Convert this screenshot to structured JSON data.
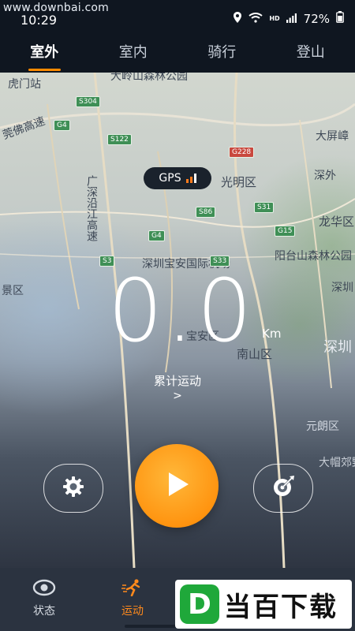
{
  "watermark_top": "www.downbai.com",
  "status": {
    "time": "10:29",
    "hd": "HD",
    "battery": "72%"
  },
  "tabs": [
    {
      "label": "室外",
      "active": true
    },
    {
      "label": "室内"
    },
    {
      "label": "骑行"
    },
    {
      "label": "登山"
    }
  ],
  "map": {
    "labels": {
      "humen": "虎门站",
      "dalingshan": "大岭山森林公园",
      "wanguo": "莞佛高速",
      "daping": "大屏嶂",
      "guangming": "光明区",
      "shenzhen_w": "深外",
      "guangshen": "广深沿江高速",
      "longhua": "龙华区",
      "yangtai": "阳台山森林公园",
      "shenzhen2": "深圳",
      "airport": "深圳宝安国际机场",
      "jingqu": "景区",
      "baoan": "宝安区",
      "nanshan": "南山区",
      "futian": "深圳",
      "yuanlang": "元朗区",
      "damao": "大帽郊野公园"
    },
    "roads": {
      "s304": "S304",
      "g4_a": "G4",
      "s122": "S122",
      "g228": "G228",
      "s86": "S86",
      "s31": "S31",
      "g4_b": "G4",
      "g15": "G15",
      "s3": "S3",
      "s33": "S33"
    }
  },
  "gps": {
    "label": "GPS"
  },
  "distance": {
    "value": "0.0",
    "unit": "Km"
  },
  "total": {
    "label": "累计运动",
    "arrow": ">"
  },
  "controls": {
    "settings_icon": "gear-icon",
    "play_icon": "play-icon",
    "target_icon": "target-icon"
  },
  "bottom_nav": [
    {
      "label": "状态",
      "icon": "eye-icon"
    },
    {
      "label": "运动",
      "icon": "running-icon",
      "active": true
    }
  ],
  "brand_watermark": {
    "logo": "D",
    "text": "当百下载"
  },
  "colors": {
    "accent": "#ff8a00",
    "dark": "#0f1620",
    "gps_bars": "#ff7b1c"
  }
}
